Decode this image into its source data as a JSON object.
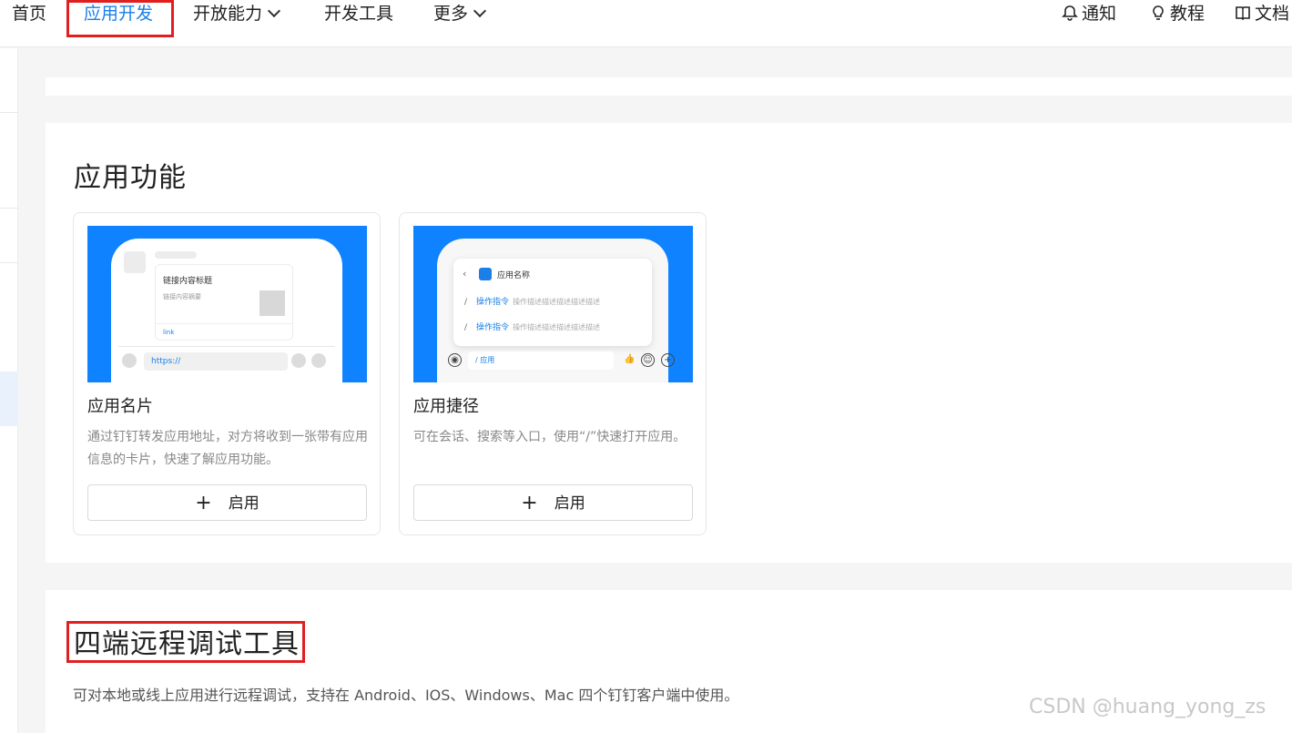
{
  "nav": {
    "home": "首页",
    "app_dev": "应用开发",
    "open_capability": "开放能力",
    "dev_tools": "开发工具",
    "more": "更多",
    "notify": "通知",
    "tutorial": "教程",
    "docs": "文档"
  },
  "app_functions": {
    "title": "应用功能",
    "cards": [
      {
        "title": "应用名片",
        "desc": "通过钉钉转发应用地址，对方将收到一张带有应用信息的卡片，快速了解应用功能。",
        "button": "启用",
        "mock": {
          "link_title": "链接内容标题",
          "link_summary": "链接内容摘要",
          "link_label": "link",
          "input_text": "https://"
        }
      },
      {
        "title": "应用捷径",
        "desc": "可在会话、搜索等入口，使用“/”快速打开应用。",
        "button": "启用",
        "mock": {
          "app_name": "应用名称",
          "slash": "/",
          "command": "操作指令",
          "command_desc": "操作描述描述描述描述描述",
          "input_text": "/ 应用"
        }
      }
    ]
  },
  "remote_debug": {
    "title": "四端远程调试工具",
    "desc": "可对本地或线上应用进行远程调试，支持在 Android、IOS、Windows、Mac 四个钉钉客户端中使用。"
  },
  "watermark": "CSDN @huang_yong_zs",
  "colors": {
    "accent": "#1a7fe8",
    "thumb_bg": "#0f83ff",
    "highlight_box": "#e02020"
  }
}
